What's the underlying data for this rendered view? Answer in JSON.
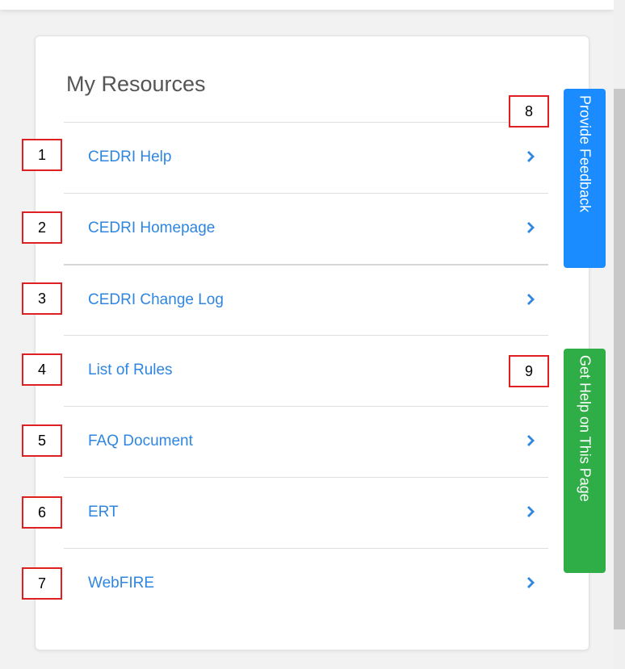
{
  "panel": {
    "title": "My Resources",
    "items": [
      {
        "label": "CEDRI Help",
        "marker": "1",
        "has_chevron": true
      },
      {
        "label": "CEDRI Homepage",
        "marker": "2",
        "has_chevron": true
      },
      {
        "label": "CEDRI Change Log",
        "marker": "3",
        "has_chevron": true
      },
      {
        "label": "List of Rules",
        "marker": "4",
        "has_chevron": false
      },
      {
        "label": "FAQ Document",
        "marker": "5",
        "has_chevron": true
      },
      {
        "label": "ERT",
        "marker": "6",
        "has_chevron": true
      },
      {
        "label": "WebFIRE",
        "marker": "7",
        "has_chevron": true
      }
    ]
  },
  "side_tabs": {
    "feedback": {
      "label": "Provide Feedback",
      "marker": "8",
      "color": "#1a8cff"
    },
    "help": {
      "label": "Get Help on This Page",
      "marker": "9",
      "color": "#2fae48"
    }
  },
  "colors": {
    "link": "#2f86e0",
    "marker_border": "#e02020"
  },
  "icons": {
    "chevron": "chevron-right-icon"
  }
}
